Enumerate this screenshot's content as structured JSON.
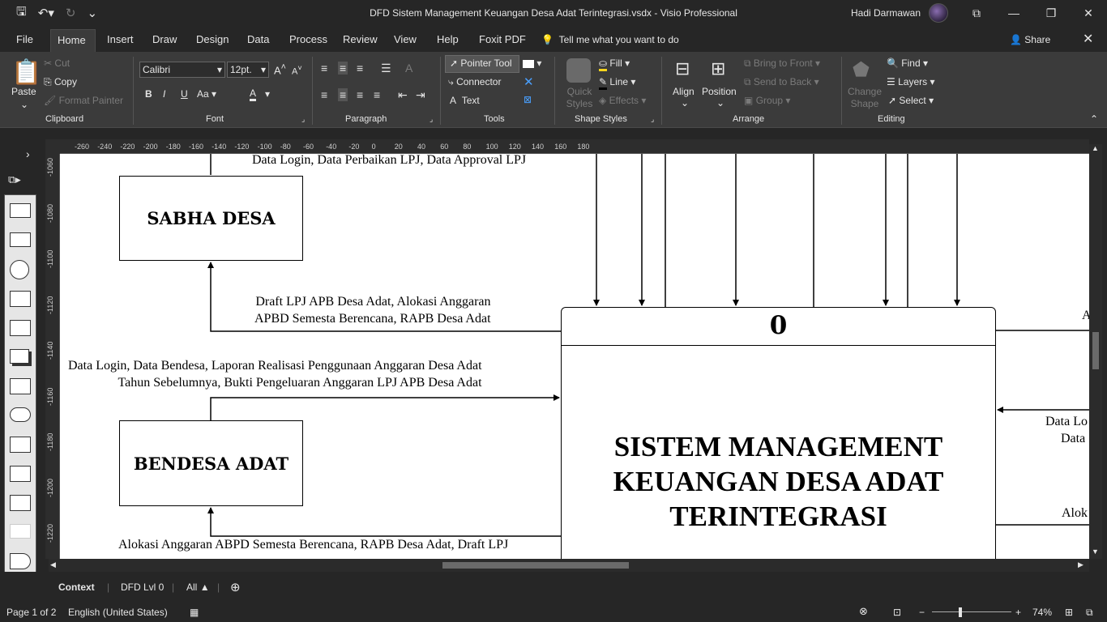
{
  "window": {
    "title": "DFD Sistem Management Keuangan Desa Adat Terintegrasi.vsdx  -  Visio Professional",
    "user": "Hadi Darmawan"
  },
  "menu": {
    "tabs": [
      "File",
      "Home",
      "Insert",
      "Draw",
      "Design",
      "Data",
      "Process",
      "Review",
      "View",
      "Help",
      "Foxit PDF"
    ],
    "active": "Home",
    "tell_me": "Tell me what you want to do",
    "share": "Share"
  },
  "ribbon": {
    "clipboard": {
      "label": "Clipboard",
      "paste": "Paste",
      "cut": "Cut",
      "copy": "Copy",
      "format_painter": "Format Painter"
    },
    "font": {
      "label": "Font",
      "family": "Calibri",
      "size": "12pt.",
      "bold": "B",
      "italic": "I",
      "underline": "U",
      "case": "Aa",
      "color": "A"
    },
    "paragraph": {
      "label": "Paragraph"
    },
    "tools": {
      "label": "Tools",
      "pointer": "Pointer Tool",
      "connector": "Connector",
      "text": "Text"
    },
    "shape_styles": {
      "label": "Shape Styles",
      "quick_styles": "Quick Styles",
      "fill": "Fill",
      "line": "Line",
      "effects": "Effects"
    },
    "arrange": {
      "label": "Arrange",
      "align": "Align",
      "position": "Position",
      "bring_front": "Bring to Front",
      "send_back": "Send to Back",
      "group": "Group"
    },
    "editing": {
      "label": "Editing",
      "change_shape": "Change Shape",
      "find": "Find",
      "layers": "Layers",
      "select": "Select"
    }
  },
  "rulers": {
    "horizontal": [
      "-260",
      "-240",
      "-220",
      "-200",
      "-180",
      "-160",
      "-140",
      "-120",
      "-100",
      "-80",
      "-60",
      "-40",
      "-20",
      "0",
      "20",
      "40",
      "60",
      "80",
      "100",
      "120",
      "140",
      "160",
      "180"
    ],
    "vertical": [
      "-1060",
      "-1080",
      "-1100",
      "-1120",
      "-1140",
      "-1160",
      "-1180",
      "-1200",
      "-1220"
    ]
  },
  "diagram": {
    "entities": {
      "sabha": "SABHA DESA",
      "bendesa": "BENDESA ADAT"
    },
    "process": {
      "number": "0",
      "name_lines": [
        "SISTEM MANAGEMENT",
        "KEUANGAN DESA ADAT",
        "TERINTEGRASI"
      ]
    },
    "flows": {
      "top": "Data Login, Data Perbaikan LPJ, Data Approval LPJ",
      "draft1": "Draft LPJ APB Desa Adat, Alokasi Anggaran",
      "draft2": "APBD Semesta Berencana, RAPB Desa Adat",
      "bendesa1": "Data Login, Data Bendesa, Laporan Realisasi Penggunaan Anggaran Desa Adat",
      "bendesa2": "Tahun Sebelumnya, Bukti Pengeluaran Anggaran LPJ APB Desa Adat",
      "bottom": "Alokasi Anggaran ABPD Semesta Berencana, RAPB Desa Adat, Draft LPJ",
      "right1": "A",
      "right2": "Data Lo",
      "right3": "Data",
      "right4": "Alok"
    }
  },
  "pages": {
    "tabs": [
      "Context",
      "DFD Lvl 0",
      "All"
    ],
    "active": "Context"
  },
  "status": {
    "page": "Page 1 of 2",
    "language": "English (United States)",
    "zoom": "74%"
  }
}
